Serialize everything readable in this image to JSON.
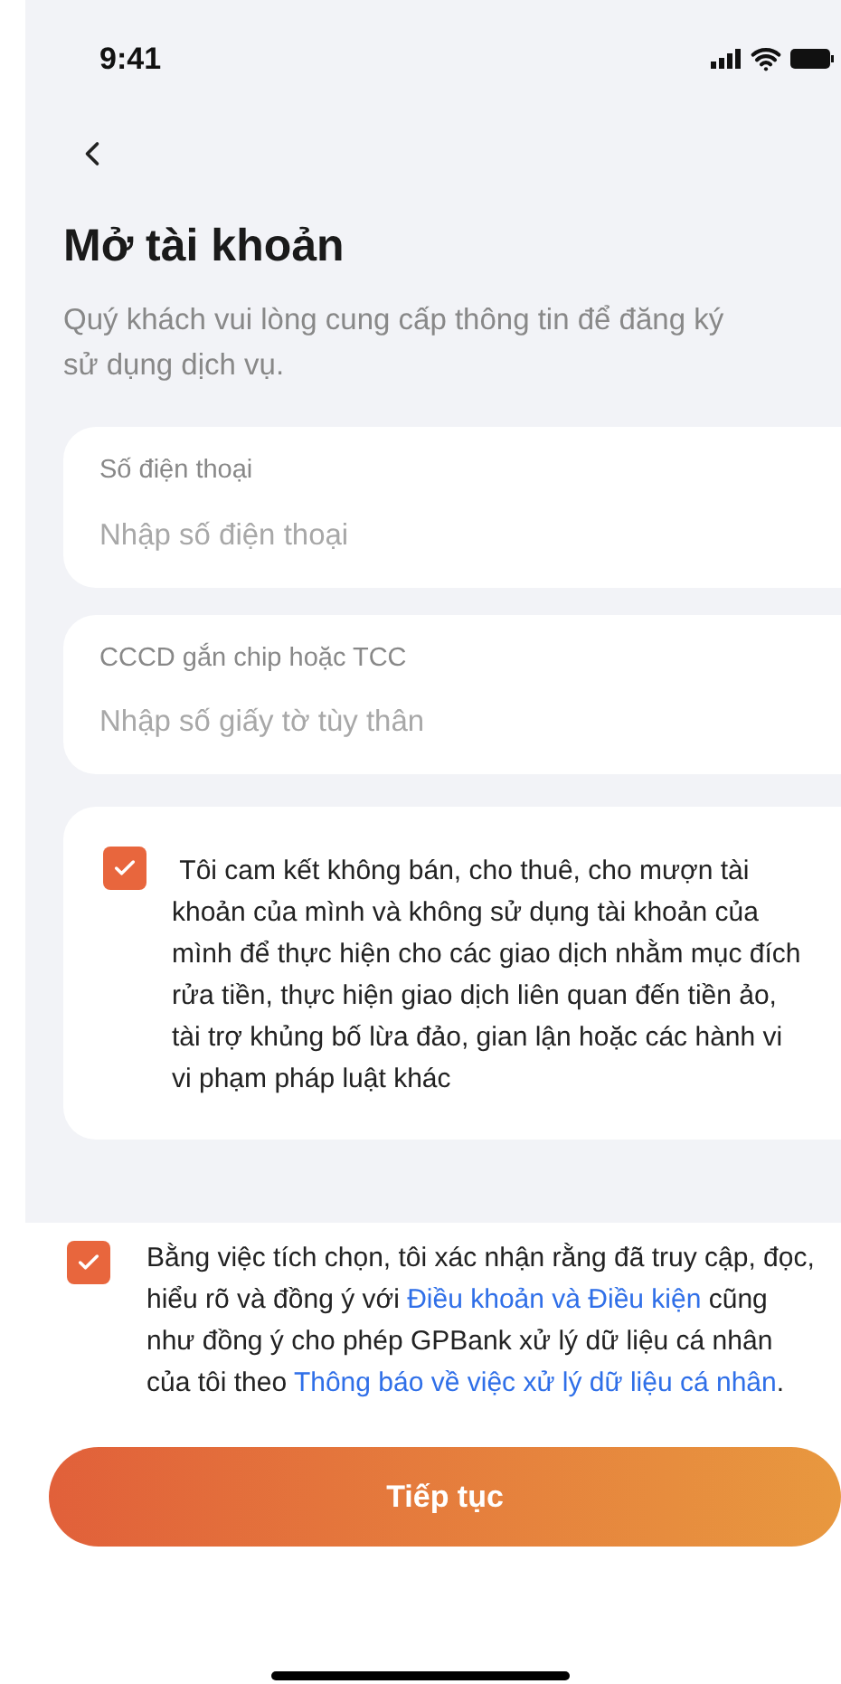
{
  "status_bar": {
    "time": "9:41"
  },
  "title": "Mở tài khoản",
  "subtitle": "Quý khách vui lòng cung cấp thông tin để đăng ký sử dụng dịch vụ.",
  "fields": [
    {
      "label": "Số điện thoại",
      "placeholder": "Nhập số điện thoại"
    },
    {
      "label": "CCCD gắn chip hoặc TCC",
      "placeholder": "Nhập số giấy tờ tùy thân"
    }
  ],
  "commitment": {
    "checked": true,
    "text": " Tôi cam kết không bán, cho thuê, cho mượn tài khoản của mình và không sử dụng tài khoản của mình để thực hiện cho các giao dịch nhằm mục đích rửa tiền, thực hiện giao dịch liên quan đến tiền ảo, tài trợ khủng bố lừa đảo, gian lận hoặc các hành vi vi phạm pháp luật khác"
  },
  "consent": {
    "checked": true,
    "segments": [
      {
        "kind": "text",
        "text": "Bằng việc tích chọn, tôi xác nhận rằng đã truy cập, đọc, hiểu rõ và đồng ý với "
      },
      {
        "kind": "link",
        "text": "Điều khoản và Điều kiện"
      },
      {
        "kind": "text",
        "text": " cũng như đồng ý cho phép GPBank xử lý dữ liệu cá nhân của tôi theo "
      },
      {
        "kind": "link",
        "text": "Thông báo về việc xử lý dữ liệu cá nhân"
      },
      {
        "kind": "text",
        "text": "."
      }
    ]
  },
  "button": {
    "label": "Tiếp tục"
  }
}
